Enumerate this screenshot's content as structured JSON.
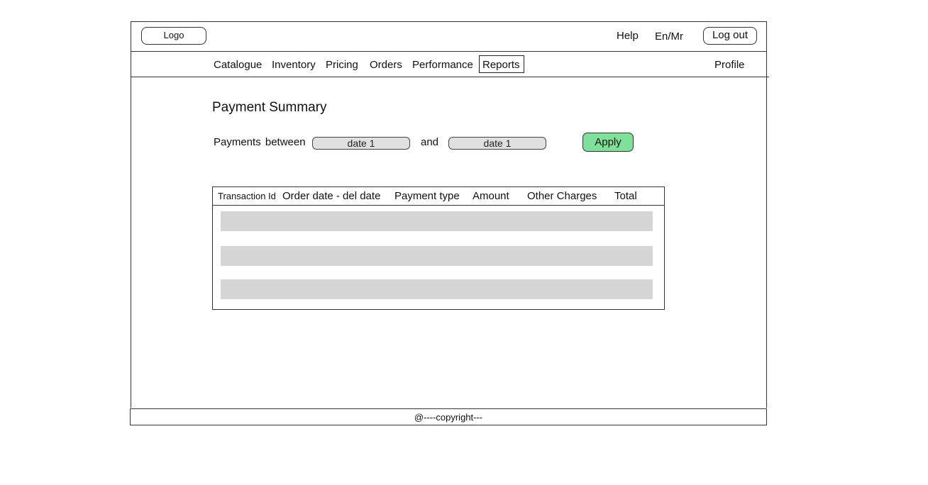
{
  "header": {
    "logo": "Logo",
    "help": "Help",
    "language": "En/Mr",
    "logout": "Log out"
  },
  "nav": {
    "items": [
      "Catalogue",
      "Inventory",
      "Pricing",
      "Orders",
      "Performance",
      "Reports"
    ],
    "active": "Reports",
    "profile": "Profile"
  },
  "main": {
    "title": "Payment Summary",
    "filter": {
      "label": "Payments  between",
      "date_from": "date 1",
      "and_label": "and",
      "date_to": "date 1",
      "apply": "Apply"
    },
    "table": {
      "columns": [
        "Transaction Id",
        "Order date - del date",
        "Payment type",
        "Amount",
        "Other Charges",
        "Total"
      ],
      "rows": 3
    }
  },
  "footer": {
    "text": "@----copyright---"
  },
  "colors": {
    "apply_button": "#7fe09a",
    "placeholder_row": "#d5d5d5",
    "date_field": "#e0e0e0"
  }
}
